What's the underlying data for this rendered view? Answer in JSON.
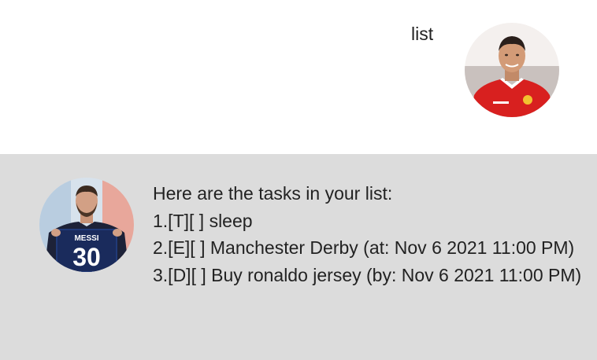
{
  "user_message": {
    "text": "list",
    "avatar_icon": "user-avatar-red-jersey"
  },
  "bot_message": {
    "avatar_icon": "bot-avatar-holding-jersey",
    "jersey_name": "MESSI",
    "jersey_number": "30",
    "lines": [
      "Here are the tasks in your list:",
      "1.[T][ ] sleep",
      "2.[E][ ] Manchester Derby (at: Nov 6 2021 11:00 PM)",
      "3.[D][ ] Buy ronaldo jersey (by: Nov 6 2021 11:00 PM)"
    ]
  },
  "colors": {
    "user_row_bg": "#ffffff",
    "bot_row_bg": "#dcdcdc",
    "text": "#222222"
  }
}
